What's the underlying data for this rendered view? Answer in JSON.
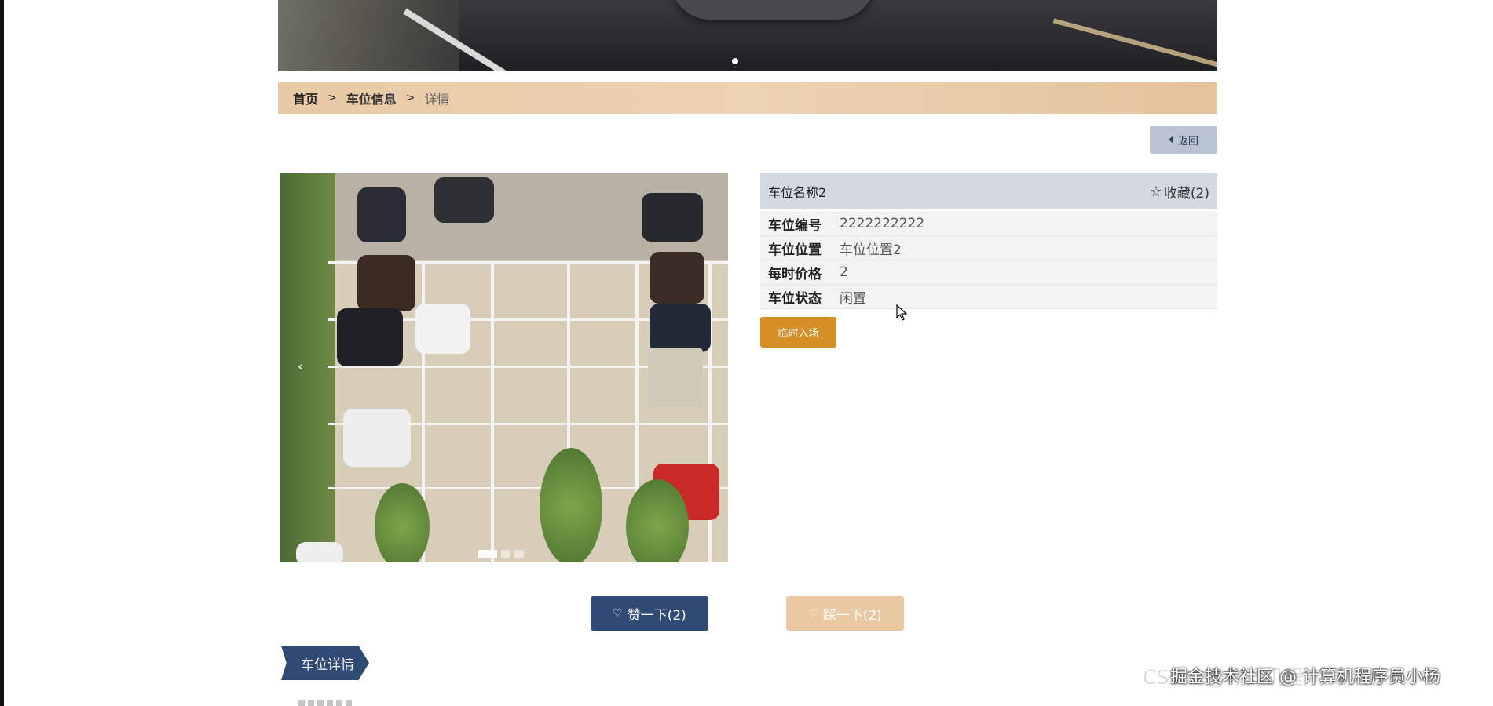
{
  "breadcrumb": {
    "home": "首页",
    "separator": ">",
    "section": "车位信息",
    "current": "详情"
  },
  "back_button": {
    "label": "返回",
    "icon": "caret-left-icon"
  },
  "carousel": {
    "slide_count": 3,
    "active_index": 0,
    "prev_arrow": "‹"
  },
  "detail": {
    "title": "车位名称2",
    "favorite": {
      "label": "收藏(2)",
      "icon": "star-outline-icon"
    },
    "fields": [
      {
        "key": "车位编号",
        "value": "2222222222"
      },
      {
        "key": "车位位置",
        "value": "车位位置2"
      },
      {
        "key": "每时价格",
        "value": "2"
      },
      {
        "key": "车位状态",
        "value": "闲置"
      }
    ],
    "enter_button": "临时入场"
  },
  "votes": {
    "like_label": "赞一下(2)",
    "dislike_label": "踩一下(2)"
  },
  "section_tab": "车位详情",
  "watermark": {
    "back": "CSDN @计算机程序员小杨",
    "front": "掘金技术社区 @ 计算机程序员小杨"
  },
  "colors": {
    "primary": "#2f4a74",
    "accent": "#d58f26",
    "breadcrumb_bg": "#e8c9a5",
    "header_bg": "#d4d9e1"
  }
}
